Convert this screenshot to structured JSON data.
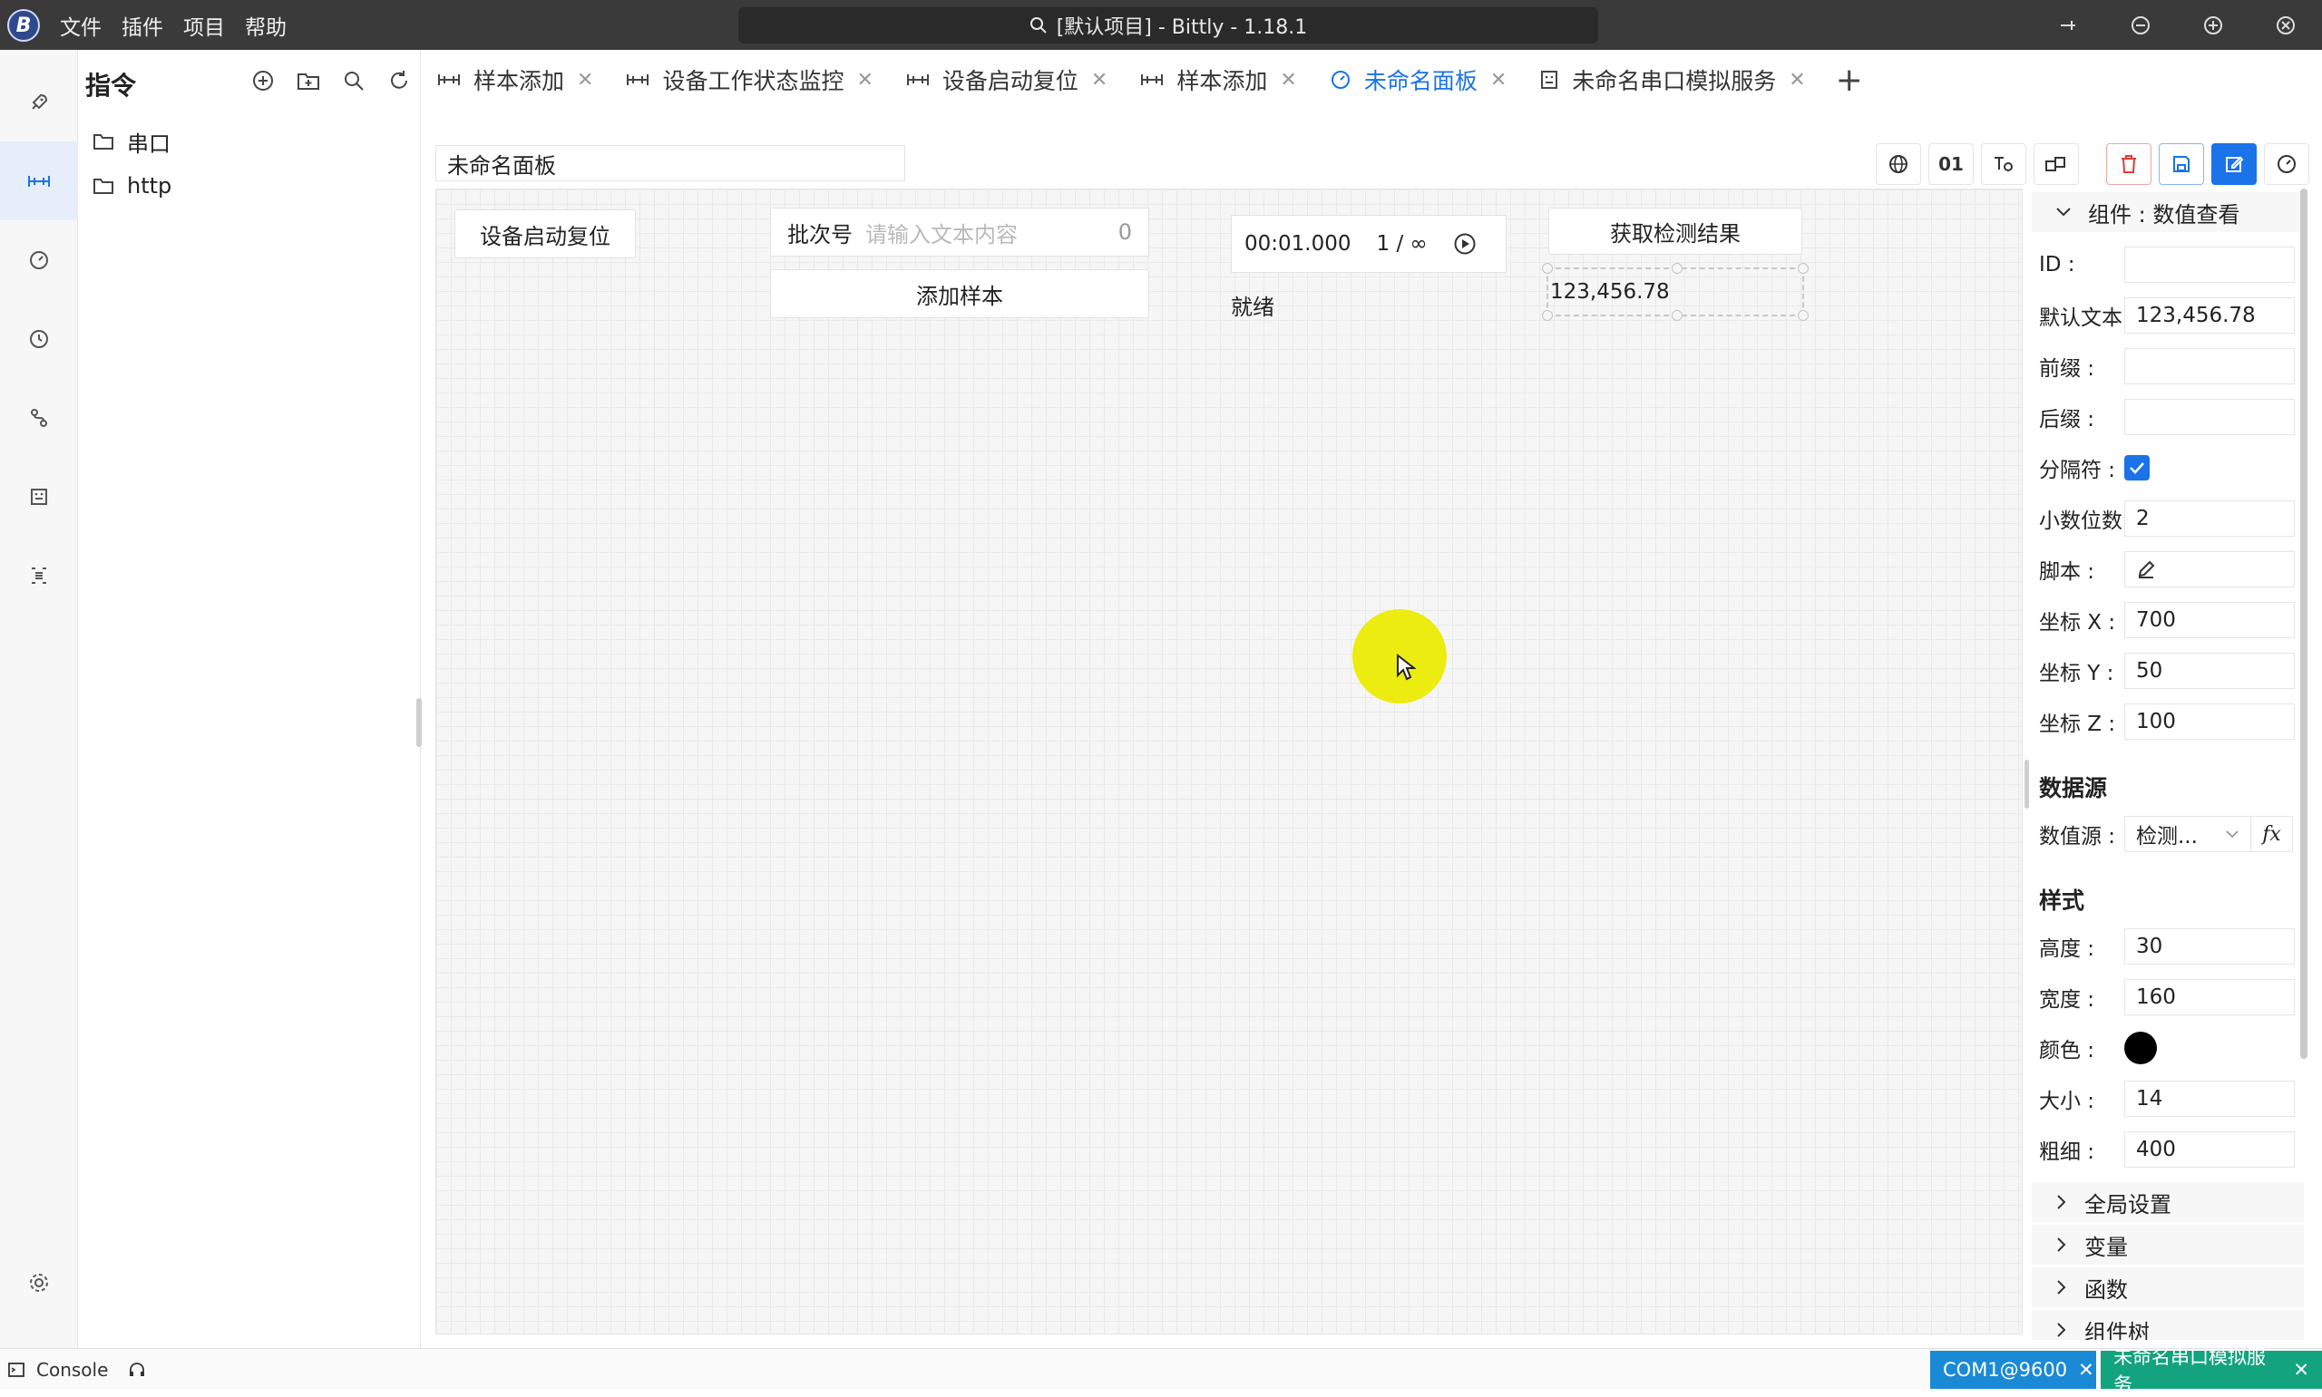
{
  "app": {
    "title": "[默认项目] - Bittly - 1.18.1",
    "logo_letter": "B",
    "menu": [
      "文件",
      "插件",
      "项目",
      "帮助"
    ]
  },
  "explorer": {
    "title": "指令",
    "tree": [
      {
        "label": "串口",
        "icon": "folder-icon"
      },
      {
        "label": "http",
        "icon": "folder-icon"
      }
    ]
  },
  "tabs": [
    {
      "label": "样本添加",
      "icon": "command-icon",
      "active": false
    },
    {
      "label": "设备工作状态监控",
      "icon": "command-icon",
      "active": false
    },
    {
      "label": "设备启动复位",
      "icon": "command-icon",
      "active": false
    },
    {
      "label": "样本添加",
      "icon": "command-icon",
      "active": false
    },
    {
      "label": "未命名面板",
      "icon": "dashboard-icon",
      "active": true
    },
    {
      "label": "未命名串口模拟服务",
      "icon": "mock-service-icon",
      "active": false
    }
  ],
  "panel": {
    "name": "未命名面板",
    "toolbar": {
      "binary_label": "01"
    }
  },
  "canvas": {
    "reset_button": "设备启动复位",
    "batch_input": {
      "label": "批次号",
      "placeholder": "请输入文本内容",
      "count": "0"
    },
    "add_sample_button": "添加样本",
    "timer": {
      "time": "00:01.000",
      "loop": "1 / ∞"
    },
    "status_text": "就绪",
    "fetch_button": "获取检测结果",
    "number_display": "123,456.78"
  },
  "props": {
    "component_header": "组件 : 数值查看",
    "fields": {
      "id": {
        "label": "ID :",
        "value": ""
      },
      "default_text": {
        "label": "默认文本",
        "value": "123,456.78"
      },
      "prefix": {
        "label": "前缀 :",
        "value": ""
      },
      "suffix": {
        "label": "后缀 :",
        "value": ""
      },
      "separator": {
        "label": "分隔符 :",
        "checked": true
      },
      "decimals": {
        "label": "小数位数",
        "value": "2"
      },
      "script": {
        "label": "脚本 :"
      },
      "pos_x": {
        "label": "坐标 X :",
        "value": "700"
      },
      "pos_y": {
        "label": "坐标 Y :",
        "value": "50"
      },
      "pos_z": {
        "label": "坐标 Z :",
        "value": "100"
      }
    },
    "datasource_title": "数据源",
    "datasource": {
      "label": "数值源 :",
      "value": "检测...",
      "fx": "fx"
    },
    "style_title": "样式",
    "style": {
      "height": {
        "label": "高度 :",
        "value": "30"
      },
      "width": {
        "label": "宽度 :",
        "value": "160"
      },
      "color": {
        "label": "颜色 :",
        "value": "#000000"
      },
      "size": {
        "label": "大小 :",
        "value": "14"
      },
      "weight": {
        "label": "粗细 :",
        "value": "400"
      }
    },
    "groups": [
      "全局设置",
      "变量",
      "函数",
      "组件树"
    ]
  },
  "statusbar": {
    "console": "Console",
    "chips": [
      {
        "label": "COM1@9600",
        "color": "#1a8ad6"
      },
      {
        "label": "未命名串口模拟服务",
        "color": "#14a37f"
      }
    ]
  },
  "colors": {
    "accent": "#1a73e8",
    "titlebar": "#3a3a3a",
    "highlight": "#ecec10"
  }
}
